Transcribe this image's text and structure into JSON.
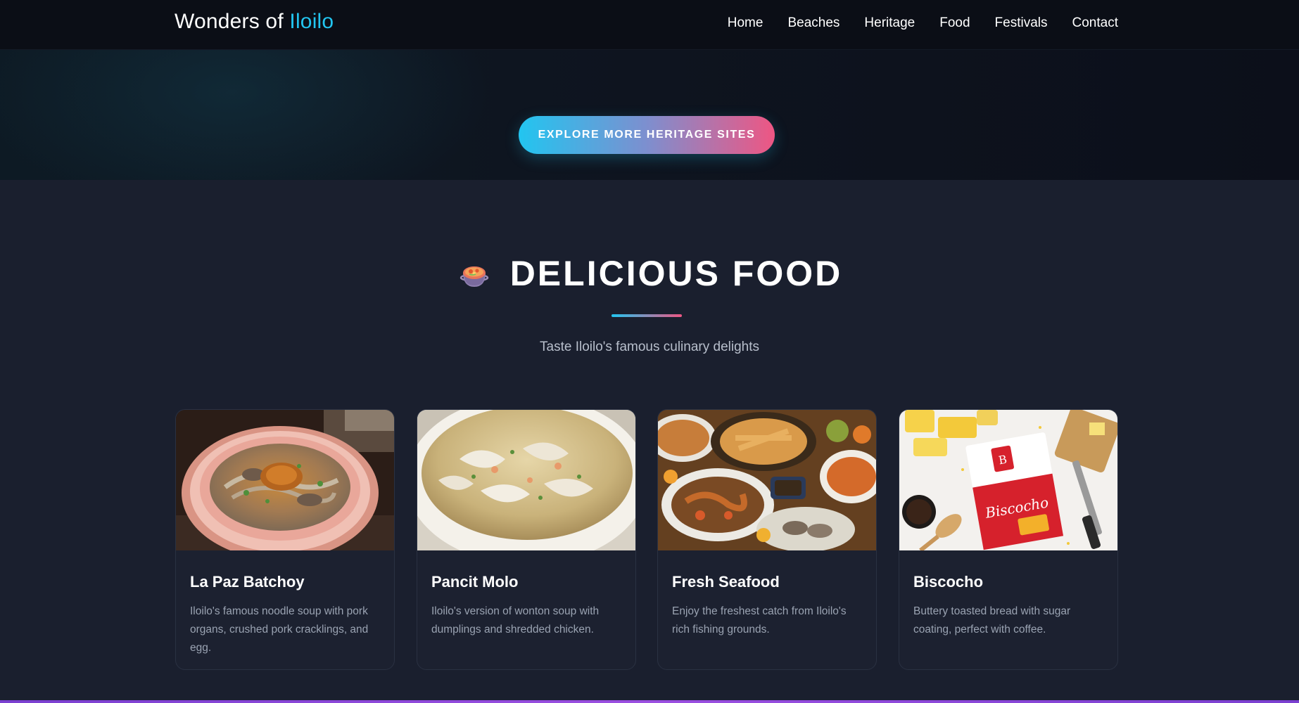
{
  "nav": {
    "brand_prefix": "Wonders of ",
    "brand_accent": "Iloilo",
    "links": [
      "Home",
      "Beaches",
      "Heritage",
      "Food",
      "Festivals",
      "Contact"
    ]
  },
  "hero": {
    "cta_label": "EXPLORE MORE HERITAGE SITES"
  },
  "food": {
    "icon": "cooking-pot-icon",
    "title": "DELICIOUS FOOD",
    "subtitle": "Taste Iloilo's famous culinary delights",
    "cards": [
      {
        "title": "La Paz Batchoy",
        "description": "Iloilo's famous noodle soup with pork organs, crushed pork cracklings, and egg.",
        "image": "batchoy-bowl-photo"
      },
      {
        "title": "Pancit Molo",
        "description": "Iloilo's version of wonton soup with dumplings and shredded chicken.",
        "image": "pancit-molo-bowl-photo"
      },
      {
        "title": "Fresh Seafood",
        "description": "Enjoy the freshest catch from Iloilo's rich fishing grounds.",
        "image": "seafood-spread-photo"
      },
      {
        "title": "Biscocho",
        "description": "Buttery toasted bread with sugar coating, perfect with coffee.",
        "image": "biscocho-package-photo",
        "package_label": "Biscocho"
      }
    ]
  },
  "colors": {
    "accent_cyan": "#22c5f0",
    "accent_pink": "#ee5683",
    "background": "#1a1f2e",
    "nav_background": "#0b0e16",
    "card_background": "#1c2130"
  }
}
